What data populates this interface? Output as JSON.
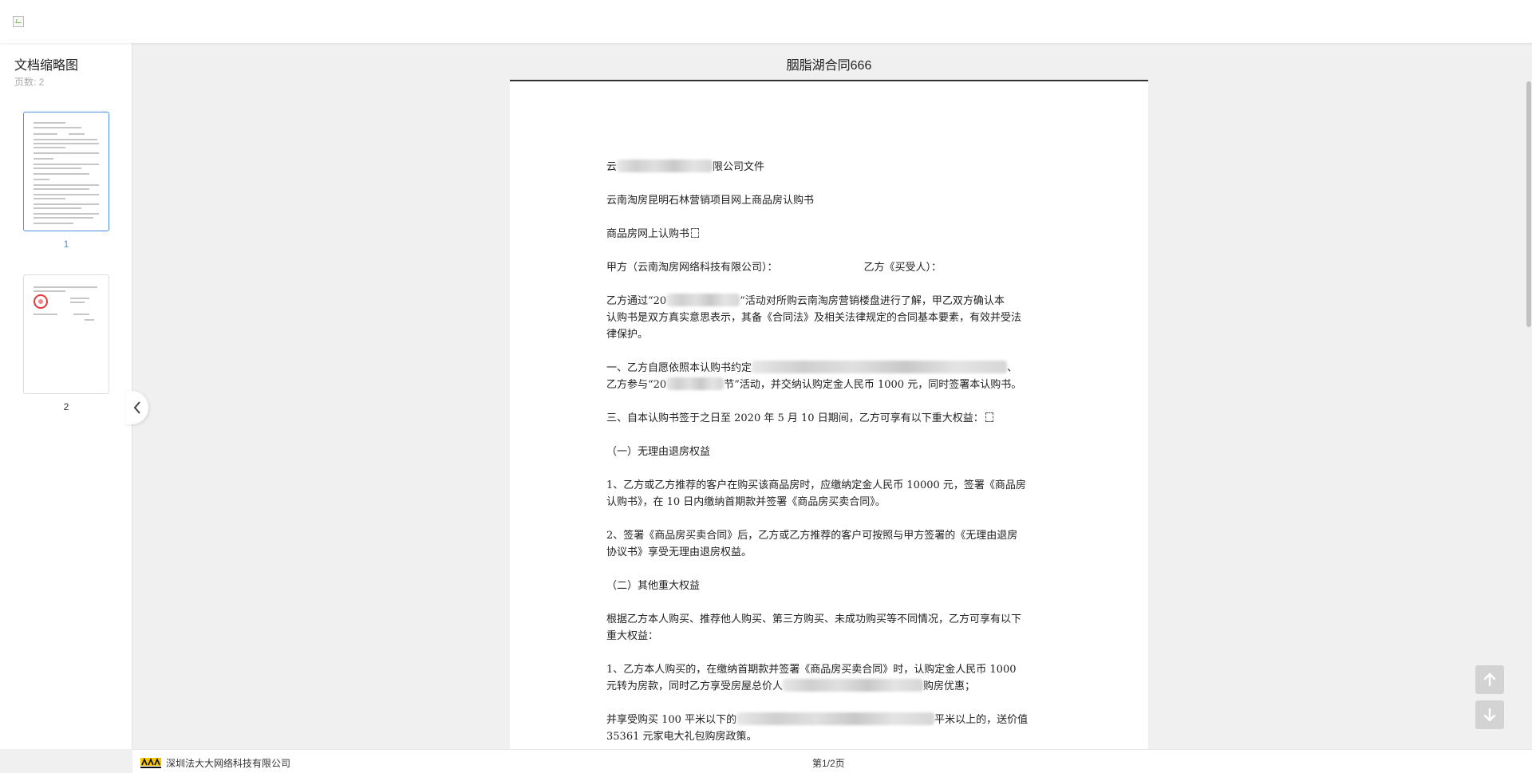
{
  "sidebar": {
    "title": "文档缩略图",
    "page_count": "页数: 2",
    "thumbnails": [
      {
        "label": "1",
        "active": true
      },
      {
        "label": "2",
        "active": false
      }
    ]
  },
  "document": {
    "title": "胭脂湖合同666",
    "lines": [
      {
        "text": "云",
        "tail": "限公司文件",
        "redacted": true
      },
      {
        "text": "云南淘房昆明石林营销项目网上商品房认购书"
      },
      {
        "text": "商品房网上认购书",
        "qr": true
      },
      {
        "text": "甲方（云南淘房网络科技有限公司）：",
        "tail": "乙方《买受人）："
      },
      {
        "text": "乙方通过“20",
        "tail": "”活动对所购云南淘房营销楼盘进行了解，甲乙双方确认本",
        "redacted": true
      },
      {
        "text": "认购书是双方真实意思表示，其备《合同法》及相关法律规定的合同基本要素，有效并受法"
      },
      {
        "text": "律保护。"
      },
      {
        "text": "一、乙方自愿依照本认购书约定",
        "tail": "、",
        "redacted": true
      },
      {
        "text": "乙方参与“20",
        "tail": "节”活动，并交纳认购定金人民币 1000 元，同时签署本认购书。",
        "redacted": true
      },
      {
        "text": "三、自本认购书签于之日至 2020 年 5 月 10 日期间，乙方可享有以下重大权益：",
        "qr": true
      },
      {
        "text": "（一）无理由退房权益"
      },
      {
        "text": "1、乙方或乙方推荐的客户在购买该商品房时，应缴纳定金人民币 10000 元，签署《商品房"
      },
      {
        "text": "认购书》，在 10 日内缴纳首期款并签署《商品房买卖合同》。"
      },
      {
        "text": "2、签署《商品房买卖合同》后，乙方或乙方推荐的客户可按照与甲方签署的《无理由退房"
      },
      {
        "text": "协议书》享受无理由退房权益。"
      },
      {
        "text": "（二）其他重大权益"
      },
      {
        "text": "根据乙方本人购买、推荐他人购买、第三方购买、未成功购买等不同情况，乙方可享有以下"
      },
      {
        "text": "重大权益："
      },
      {
        "text": "1、乙方本人购买的，在缴纳首期款并签署《商品房买卖合同》时，认购定金人民币 1000"
      },
      {
        "text": "元转为房款，同时乙方享受房屋总价人",
        "tail": "购房优惠；",
        "redacted": true
      },
      {
        "text": "并享受购买 100 平米以下的",
        "tail": "平米以上的，送价值",
        "redacted": true
      },
      {
        "text": "35361 元家电大礼包购房政策。"
      }
    ]
  },
  "footer": {
    "company": "深圳法大大网络科技有限公司",
    "page_indicator": "第1/2页"
  },
  "icons": {
    "collapse": "chevron-left-icon",
    "scroll_up": "arrow-up-icon",
    "scroll_down": "arrow-down-icon"
  },
  "colors": {
    "accent": "#4a90e2",
    "seal": "#e03a3a",
    "background": "#f0f0f0"
  }
}
